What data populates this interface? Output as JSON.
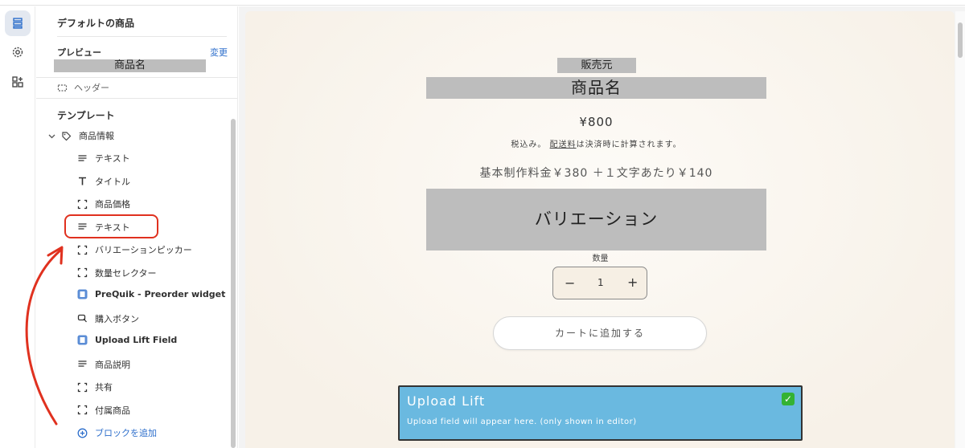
{
  "sidebar": {
    "product_title": "デフォルトの商品",
    "preview_label": "プレビュー",
    "change_link": "変更",
    "preview_product_name": "商品名",
    "header_label": "ヘッダー",
    "template_label": "テンプレート",
    "section_label": "商品情報",
    "items": [
      {
        "label": "テキスト",
        "icon": "text-icon"
      },
      {
        "label": "タイトル",
        "icon": "title-icon"
      },
      {
        "label": "商品価格",
        "icon": "block-icon"
      },
      {
        "label": "テキスト",
        "icon": "text-icon"
      },
      {
        "label": "バリエーションピッカー",
        "icon": "block-icon"
      },
      {
        "label": "数量セレクター",
        "icon": "block-icon"
      },
      {
        "label": "PreQuik - Preorder widget",
        "icon": "app-icon"
      },
      {
        "label": "購入ボタン",
        "icon": "buy-button-icon"
      },
      {
        "label": "Upload Lift Field",
        "icon": "app-icon"
      },
      {
        "label": "商品説明",
        "icon": "text-icon"
      },
      {
        "label": "共有",
        "icon": "block-icon"
      },
      {
        "label": "付属商品",
        "icon": "block-icon"
      }
    ],
    "add_block": "ブロックを追加"
  },
  "preview": {
    "vendor": "販売元",
    "product_name": "商品名",
    "price": "¥800",
    "tax_prefix": "税込み。",
    "tax_link": "配送料",
    "tax_suffix": "は決済時に計算されます。",
    "base_fee": "基本制作料金￥380 ＋１文字あたり￥140",
    "variation": "バリエーション",
    "quantity_label": "数量",
    "quantity_value": "1",
    "minus": "−",
    "plus": "+",
    "add_to_cart": "カートに追加する",
    "upload_title": "Upload Lift",
    "upload_subtitle": "Upload field will appear here. (only shown in editor)",
    "upload_check": "✓"
  },
  "colors": {
    "accent_blue": "#2c6ecb",
    "annotation_red": "#e0311f",
    "upload_bg": "#6ab9e0"
  }
}
